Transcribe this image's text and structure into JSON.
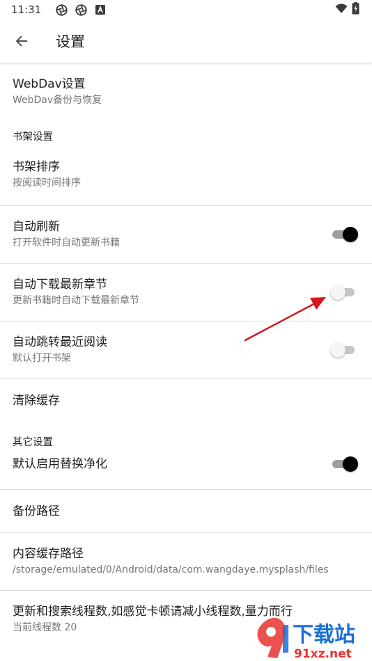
{
  "status_bar": {
    "time": "11:31",
    "icons": [
      "aperture-icon",
      "aperture-icon",
      "a-notification-icon"
    ],
    "right_icons": [
      "wifi-icon",
      "battery-icon"
    ]
  },
  "app_bar": {
    "back_icon": "arrow-left-icon",
    "title": "设置"
  },
  "prefs": {
    "webdav": {
      "title": "WebDav设置",
      "summary": "WebDav备份与恢复"
    },
    "shelf_category": "书架设置",
    "shelf_sort": {
      "title": "书架排序",
      "summary": "按阅读时间排序"
    },
    "auto_refresh": {
      "title": "自动刷新",
      "summary": "打开软件时自动更新书籍",
      "checked": true
    },
    "auto_download": {
      "title": "自动下载最新章节",
      "summary": "更新书籍时自动下载最新章节",
      "checked": false
    },
    "auto_jump": {
      "title": "自动跳转最近阅读",
      "summary": "默认打开书架",
      "checked": false
    },
    "clear_cache": {
      "title": "清除缓存"
    },
    "other_category": "其它设置",
    "replace_clean": {
      "title": "默认启用替换净化",
      "checked": true
    },
    "backup_path": {
      "title": "备份路径"
    },
    "content_cache_path": {
      "title": "内容缓存路径",
      "summary": "/storage/emulated/0/Android/data/com.wangdaye.mysplash/files"
    },
    "thread_count": {
      "title": "更新和搜索线程数,如感觉卡顿请减小线程数,量力而行",
      "summary": "当前线程数 20"
    }
  },
  "annotation": {
    "arrow_color": "#d9141c"
  },
  "watermark": {
    "brand": "下载站",
    "site": "91xz.net",
    "colors": {
      "red": "#e8322f",
      "blue": "#1b6fd6"
    }
  }
}
